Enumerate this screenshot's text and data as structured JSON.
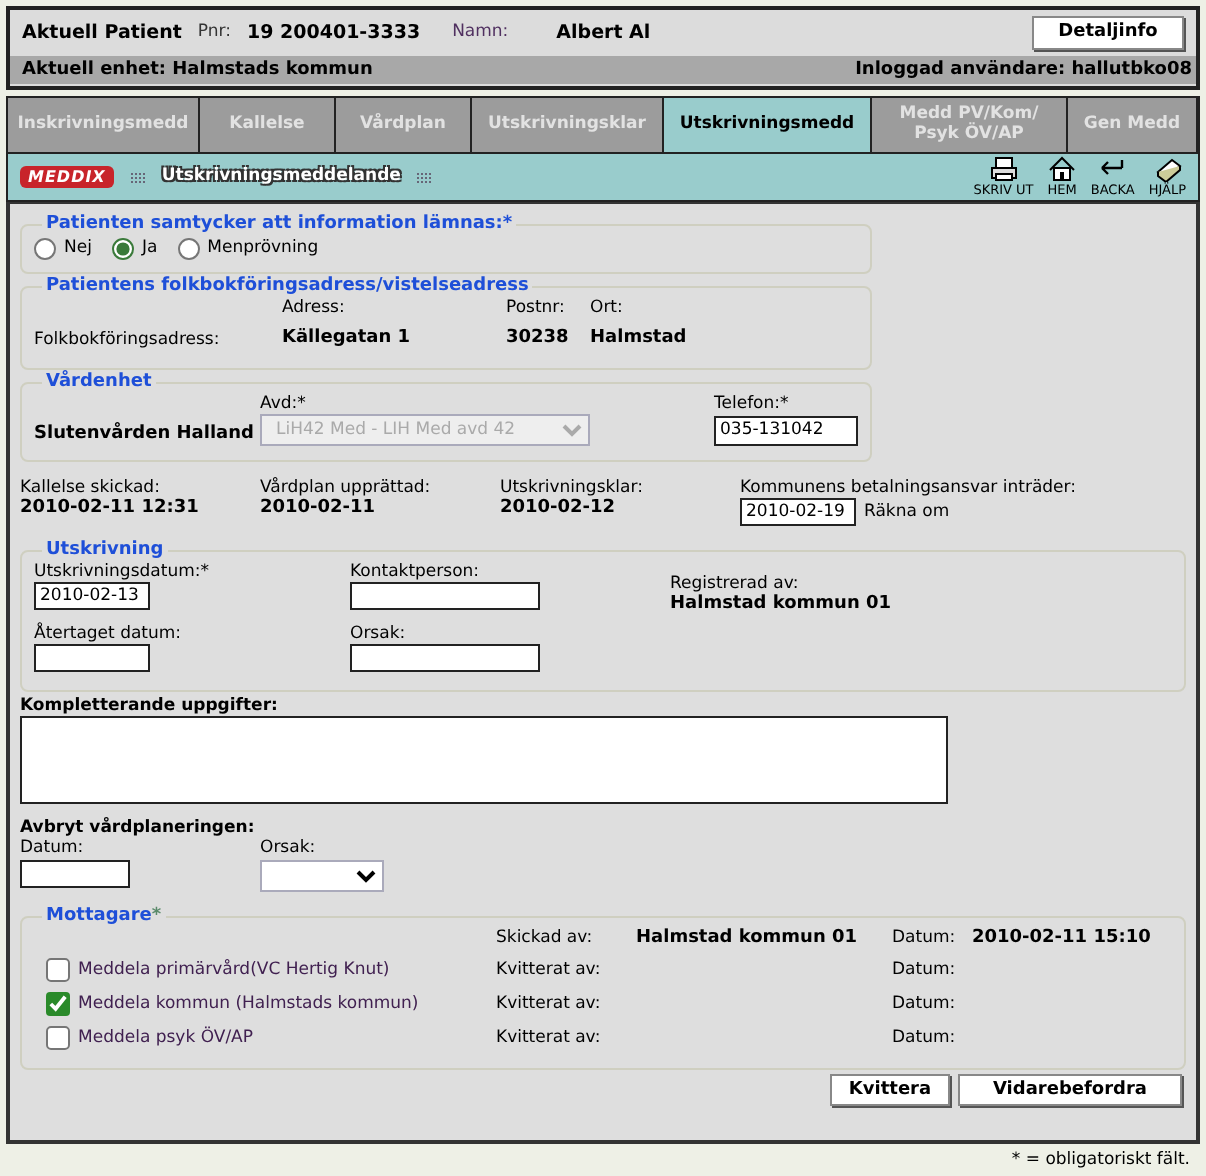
{
  "patient": {
    "label": "Aktuell Patient",
    "pnr_label": "Pnr:",
    "pnr": "19 200401-3333",
    "name_label": "Namn:",
    "name": "Albert Al",
    "details_button": "Detaljinfo",
    "unit": "Aktuell enhet: Halmstads kommun",
    "user": "Inloggad användare: hallutbko08"
  },
  "tabs": [
    {
      "label": "Inskrivningsmedd",
      "selected": false
    },
    {
      "label": "Kallelse",
      "selected": false
    },
    {
      "label": "Vårdplan",
      "selected": false
    },
    {
      "label": "Utskrivningsklar",
      "selected": false
    },
    {
      "label": "Utskrivningsmedd",
      "selected": true
    },
    {
      "label": "Medd PV/Kom/ Psyk ÖV/AP",
      "selected": false
    },
    {
      "label": "Gen Medd",
      "selected": false
    }
  ],
  "toolbar": {
    "logo": "MEDDIX",
    "title": "Utskrivningsmeddelande",
    "actions": [
      {
        "label": "SKRIV UT",
        "kind": "print"
      },
      {
        "label": "HEM",
        "kind": "home"
      },
      {
        "label": "BACKA",
        "kind": "back"
      },
      {
        "label": "HJÄLP",
        "kind": "help"
      }
    ]
  },
  "consent": {
    "legend": "Patienten samtycker att information lämnas:*",
    "options": [
      {
        "label": "Nej",
        "selected": false
      },
      {
        "label": "Ja",
        "selected": true
      },
      {
        "label": "Menprövning",
        "selected": false
      }
    ]
  },
  "address": {
    "legend": "Patientens folkbokföringsadress/vistelseadress",
    "headers": [
      "Adress:",
      "Postnr:",
      "Ort:"
    ],
    "row_label": "Folkbokföringsadress:",
    "values": [
      "Källegatan 1",
      "30238",
      "Halmstad"
    ]
  },
  "care_unit": {
    "legend": "Vårdenhet",
    "name": "Slutenvården Halland",
    "department_label": "Avd:*",
    "department": "LiH42 Med - LIH Med avd 42",
    "department_disabled": true,
    "phone_label": "Telefon:*",
    "phone": "035-131042"
  },
  "dates": [
    {
      "label": "Kallelse skickad:",
      "value": "2010-02-11 12:31"
    },
    {
      "label": "Vårdplan upprättad:",
      "value": "2010-02-11"
    },
    {
      "label": "Utskrivningsklar:",
      "value": "2010-02-12"
    }
  ],
  "payment": {
    "label": "Kommunens betalningsansvar inträder:",
    "value": "2010-02-19",
    "action": "Räkna om"
  },
  "discharge": {
    "legend": "Utskrivning",
    "date_label": "Utskrivningsdatum:*",
    "date": "2010-02-13",
    "contact_label": "Kontaktperson:",
    "withdrawn_label": "Återtaget datum:",
    "reason_label": "Orsak:",
    "registered_label": "Registrerad av:",
    "registered_by": "Halmstad kommun 01"
  },
  "supplementary": {
    "label": "Kompletterande uppgifter:"
  },
  "cancel": {
    "title": "Avbryt vårdplaneringen:",
    "date_label": "Datum:",
    "reason_label": "Orsak:"
  },
  "recipients": {
    "legend": "Mottagare",
    "required_mark": "*",
    "sent_by_label": "Skickad av:",
    "sent_by": "Halmstad kommun 01",
    "sent_date_label": "Datum:",
    "sent_date": "2010-02-11 15:10",
    "items": [
      {
        "label": "Meddela primärvård(VC Hertig Knut)",
        "checked": false,
        "ack_label": "Kvitterat av:",
        "date_label": "Datum:"
      },
      {
        "label": "Meddela kommun (Halmstads kommun)",
        "checked": true,
        "ack_label": "Kvitterat av:",
        "date_label": "Datum:"
      },
      {
        "label": "Meddela psyk ÖV/AP",
        "checked": false,
        "ack_label": "Kvitterat av:",
        "date_label": "Datum:"
      }
    ]
  },
  "buttons": [
    "Kvittera",
    "Vidarebefordra"
  ],
  "footnote": "* = obligatoriskt fält."
}
